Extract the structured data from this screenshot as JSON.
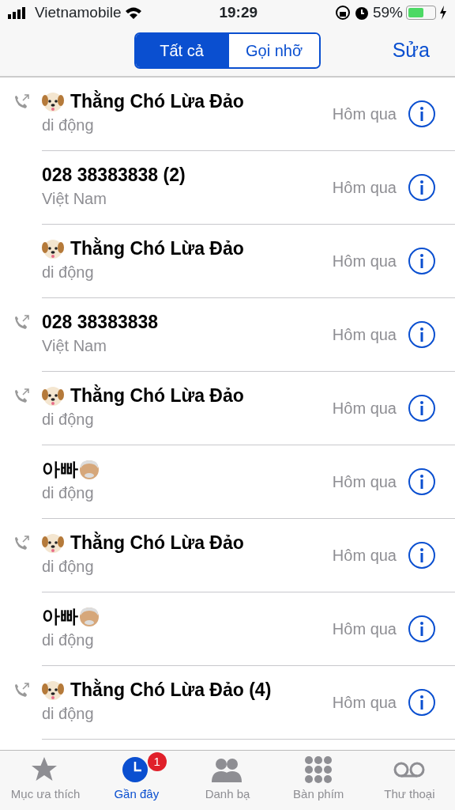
{
  "status_bar": {
    "carrier": "Vietnamobile",
    "time": "19:29",
    "battery_percent": "59%",
    "battery": {
      "level": 0.59
    }
  },
  "segments": [
    {
      "label": "Tất cả",
      "selected": true
    },
    {
      "label": "Gọi nhỡ",
      "selected": false
    }
  ],
  "edit_button": "Sửa",
  "calls": [
    {
      "name": "Thằng Chó Lừa Đảo",
      "kind": "dog",
      "outgoing": true,
      "detail": "di động",
      "date": "Hôm qua"
    },
    {
      "name": "028 38383838 (2)",
      "kind": "plain",
      "outgoing": false,
      "detail": "Việt Nam",
      "date": "Hôm qua"
    },
    {
      "name": "Thằng Chó Lừa Đảo",
      "kind": "dog",
      "outgoing": false,
      "detail": "di động",
      "date": "Hôm qua"
    },
    {
      "name": "028 38383838",
      "kind": "plain",
      "outgoing": true,
      "detail": "Việt Nam",
      "date": "Hôm qua"
    },
    {
      "name": "Thằng Chó Lừa Đảo",
      "kind": "dog",
      "outgoing": true,
      "detail": "di động",
      "date": "Hôm qua"
    },
    {
      "name": "아빠",
      "kind": "old-man",
      "outgoing": false,
      "detail": "di động",
      "date": "Hôm qua"
    },
    {
      "name": "Thằng Chó Lừa Đảo",
      "kind": "dog",
      "outgoing": true,
      "detail": "di động",
      "date": "Hôm qua"
    },
    {
      "name": "아빠",
      "kind": "old-man",
      "outgoing": false,
      "detail": "di động",
      "date": "Hôm qua"
    },
    {
      "name": "Thằng Chó Lừa Đảo (4)",
      "kind": "dog",
      "outgoing": true,
      "detail": "di động",
      "date": "Hôm qua"
    }
  ],
  "tab_bar": [
    {
      "kind": "star",
      "label": "Mục ưa thích",
      "selected": false
    },
    {
      "kind": "clock",
      "label": "Gần đây",
      "selected": true,
      "badge": "1"
    },
    {
      "kind": "contacts",
      "label": "Danh bạ",
      "selected": false
    },
    {
      "kind": "keypad",
      "label": "Bàn phím",
      "selected": false
    },
    {
      "kind": "voicemail",
      "label": "Thư thoại",
      "selected": false
    }
  ]
}
